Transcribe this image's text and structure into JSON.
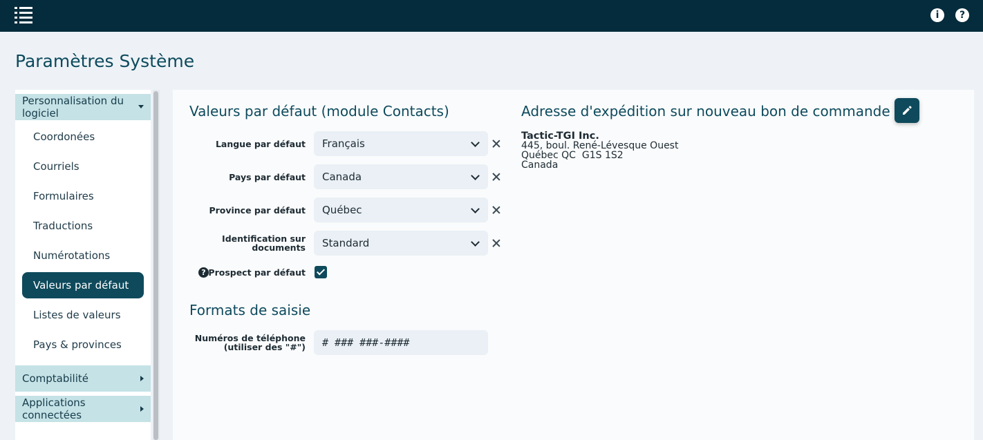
{
  "topbar": {
    "menu_icon": "menu-list-icon",
    "info_icon": "info-icon",
    "info_glyph": "i",
    "help_icon": "help-icon",
    "help_glyph": "?"
  },
  "page": {
    "title": "Paramètres Système"
  },
  "sidebar": {
    "groups": [
      {
        "label": "Personnalisation du logiciel",
        "expanded": true
      },
      {
        "label": "Comptabilité",
        "expanded": false
      },
      {
        "label": "Applications connectées",
        "expanded": false
      }
    ],
    "items": [
      {
        "label": "Coordonées"
      },
      {
        "label": "Courriels"
      },
      {
        "label": "Formulaires"
      },
      {
        "label": "Traductions"
      },
      {
        "label": "Numérotations"
      },
      {
        "label": "Valeurs par défaut",
        "active": true
      },
      {
        "label": "Listes de valeurs"
      },
      {
        "label": "Pays & provinces"
      }
    ]
  },
  "defaults": {
    "title": "Valeurs par défaut (module Contacts)",
    "fields": [
      {
        "label": "Langue par défaut",
        "value": "Français"
      },
      {
        "label": "Pays par défaut",
        "value": "Canada"
      },
      {
        "label": "Province par défaut",
        "value": "Québec"
      },
      {
        "label": "Identification sur documents",
        "value": "Standard"
      }
    ],
    "prospect": {
      "label": "Prospect par défaut",
      "checked": true
    }
  },
  "formats": {
    "title": "Formats de saisie",
    "phone": {
      "label_line1": "Numéros de téléphone",
      "label_line2": "(utiliser des \"#\")",
      "value": "# ### ###-####"
    }
  },
  "shipping": {
    "title": "Adresse d'expédition sur nouveau bon de commande",
    "edit_icon": "pencil-icon",
    "address_lines": [
      "Tactic-TGI Inc.",
      "445, boul. René-Lévesque Ouest",
      "Québec QC  G1S 1S2",
      "Canada"
    ]
  },
  "colors": {
    "topbar": "#052c3c",
    "accent": "#0e4a5c",
    "group_header": "#c5e2e6",
    "title": "#0d4a5d"
  }
}
